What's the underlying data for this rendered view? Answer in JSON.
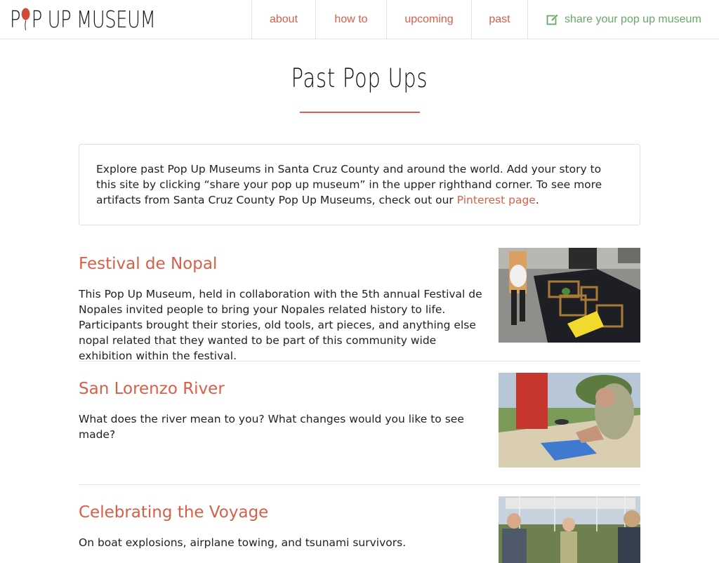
{
  "header": {
    "logo_text": "POP UP MUSEUM",
    "nav": {
      "about": "about",
      "how_to": "how to",
      "upcoming": "upcoming",
      "past": "past",
      "share": "share your pop up museum"
    }
  },
  "page": {
    "title": "Past Pop Ups",
    "intro_before_link": "Explore past Pop Up Museums in Santa Cruz County and around the world. Add your story to this site by clicking “share your pop up museum” in the upper righthand corner. To see more artifacts from Santa Cruz County Pop Up Museums, check out our ",
    "intro_link": "Pinterest page",
    "intro_after_link": "."
  },
  "entries": [
    {
      "title": "Festival de Nopal",
      "description": "This Pop Up Museum, held in collaboration with the 5th annual Festival de Nopales invited people to bring your Nopales related history to life. Participants brought their stories, old tools, art pieces, and anything else nopal related that they wanted to be part of this community wide exhibition within the festival."
    },
    {
      "title": "San Lorenzo River",
      "description": "What does the river mean to you? What changes would you like to see made?"
    },
    {
      "title": "Celebrating the Voyage",
      "description": "On boat explosions, airplane towing, and tsunami survivors."
    }
  ],
  "colors": {
    "accent": "#d75f48",
    "share_green": "#6aa86a",
    "border": "#e3e3e3"
  }
}
